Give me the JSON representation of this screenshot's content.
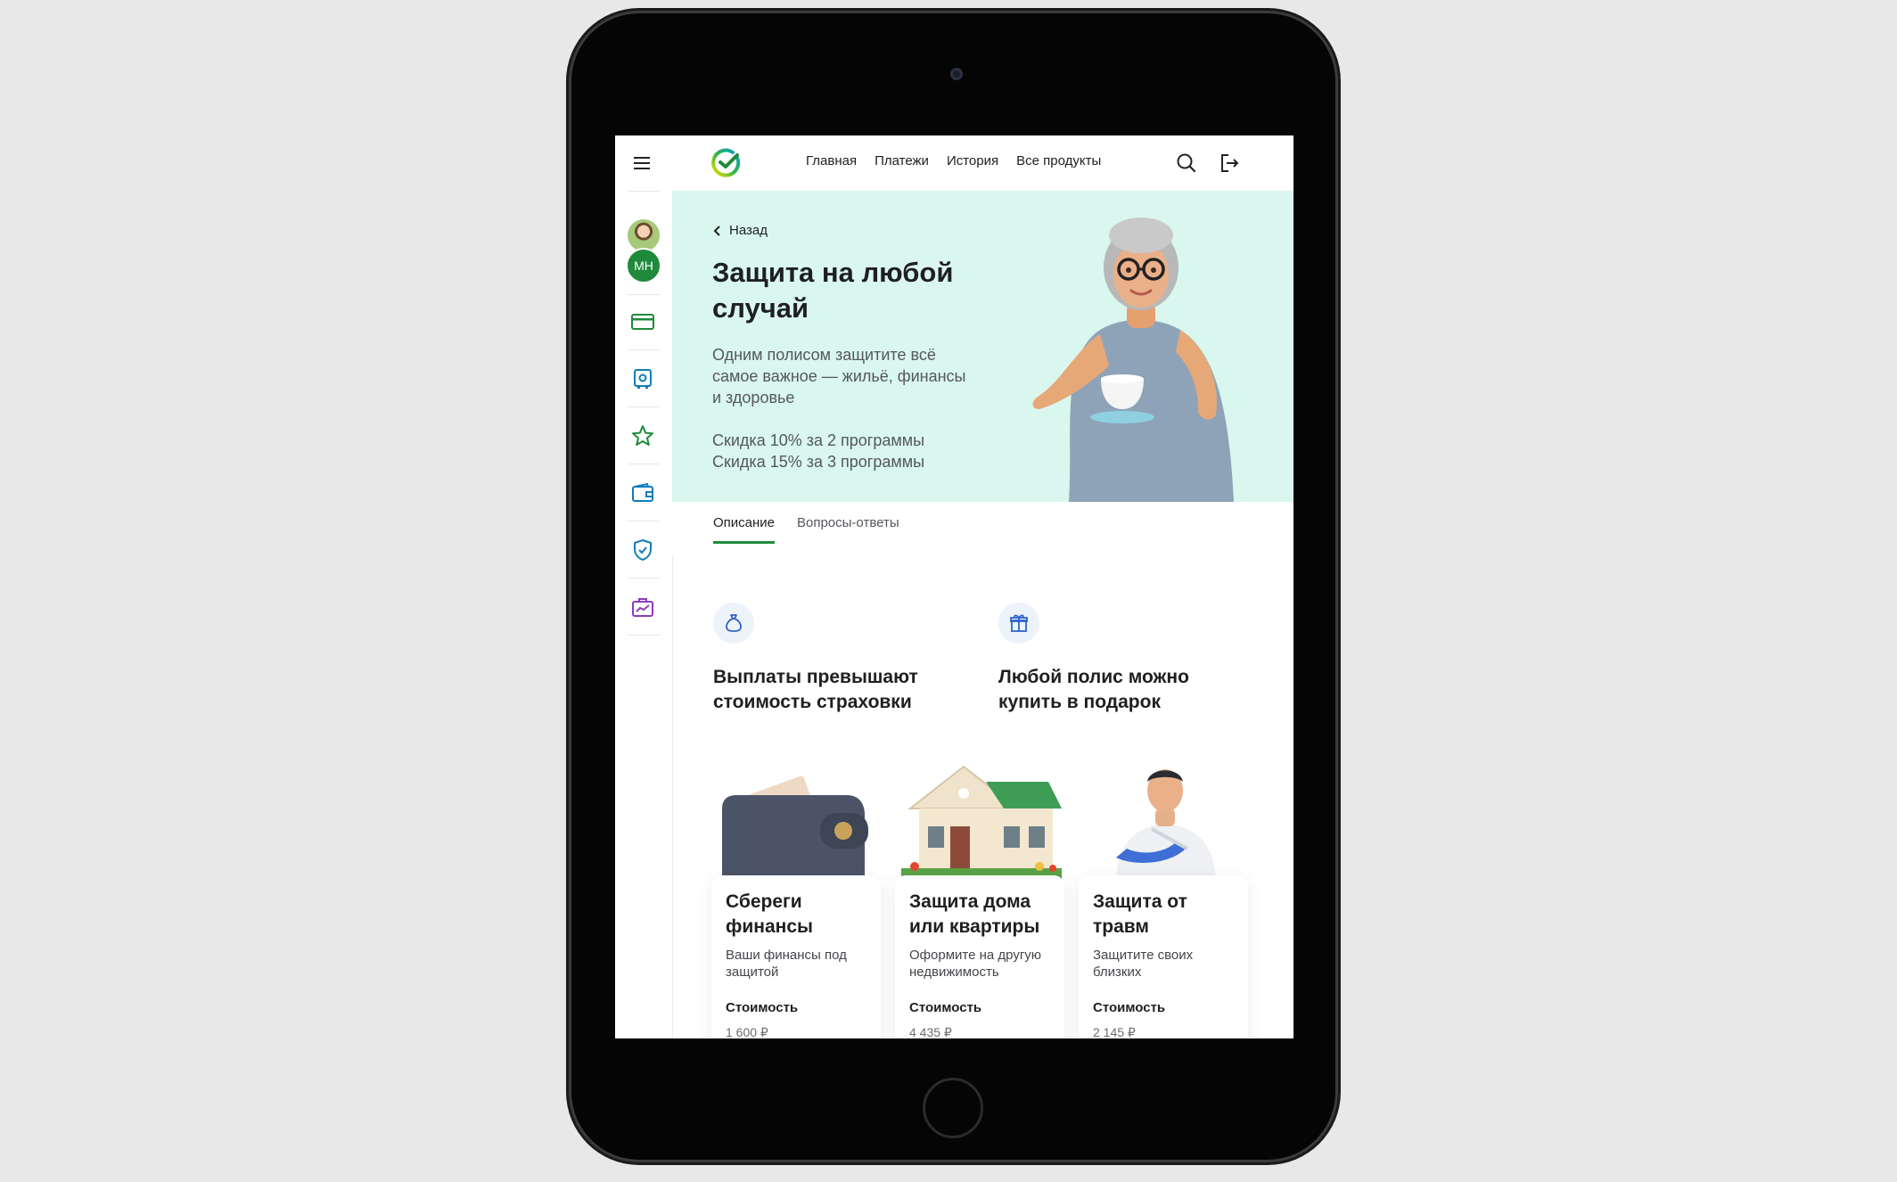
{
  "header": {
    "nav": [
      "Главная",
      "Платежи",
      "История",
      "Все продукты"
    ]
  },
  "sidebar": {
    "avatar_initials": "МН"
  },
  "hero": {
    "back_label": "Назад",
    "title": "Защита на любой случай",
    "description": "Одним полисом защитите всё самое важное — жильё, финансы и здоровье",
    "discount_1": "Скидка 10% за 2 программы",
    "discount_2": "Скидка 15% за 3 программы"
  },
  "tabs": [
    {
      "label": "Описание",
      "active": true
    },
    {
      "label": "Вопросы-ответы",
      "active": false
    }
  ],
  "features": [
    {
      "icon": "money-bag-icon",
      "text": "Выплаты превышают стоимость страховки"
    },
    {
      "icon": "gift-icon",
      "text": "Любой полис можно купить в подарок"
    }
  ],
  "cards": [
    {
      "title": "Сбереги финансы",
      "subtitle": "Ваши финансы под защитой",
      "cost_label": "Стоимость",
      "price": "1 600 ₽",
      "image": "wallet"
    },
    {
      "title": "Защита дома или квартиры",
      "subtitle": "Оформите на другую недвижимость",
      "cost_label": "Стоимость",
      "price": "4 435 ₽",
      "image": "house"
    },
    {
      "title": "Защита от травм",
      "subtitle": "Защитите своих близких",
      "cost_label": "Стоимость",
      "price": "2 145 ₽",
      "image": "man-with-sling"
    }
  ],
  "colors": {
    "brand_green": "#1f8a3b",
    "hero_background": "#d9f7ee",
    "device_frame": "#050505"
  }
}
